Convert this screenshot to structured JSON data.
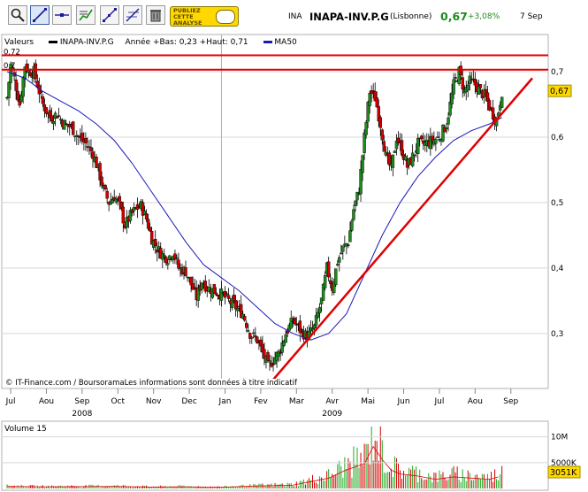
{
  "toolbar": {
    "buttons": [
      {
        "name": "zoom-button",
        "icon": "zoom-icon"
      },
      {
        "name": "trendline-tool-button",
        "icon": "trendline-icon",
        "selected": true
      },
      {
        "name": "horizontal-line-tool-button",
        "icon": "horizontal-line-icon"
      },
      {
        "name": "indicator-button",
        "icon": "indicator-chart-icon"
      },
      {
        "name": "trendline-alt-button",
        "icon": "trendline-icon"
      },
      {
        "name": "fibonacci-button",
        "icon": "fibonacci-icon"
      },
      {
        "name": "delete-button",
        "icon": "trash-icon"
      }
    ],
    "ad_text": [
      "PUBLIEZ",
      "CETTE",
      "ANALYSE"
    ]
  },
  "header": {
    "code": "INA",
    "name": "INAPA-INV.P.G",
    "market": "(Lisbonne)",
    "price": "0,67",
    "change": "+3,08%",
    "date": "7 Sep",
    "price_color": "#1e8a1e"
  },
  "legend": {
    "series_label": "Valeurs",
    "ticker": "INAPA-INV.P.G",
    "range": "Année +Bas: 0,23 +Haut: 0,71",
    "ma_label": "MA50"
  },
  "credit": "© IT-Finance.com / BoursoramaLes informations sont données à titre indicatif",
  "volume_label": "Volume 15",
  "colors": {
    "up": "#1e8a1e",
    "down": "#d00000",
    "ma": "#1a1ab8",
    "line": "#e00000",
    "volume": "#22aa22",
    "grid": "#d8d8d8"
  },
  "chart_data": {
    "type": "candlestick",
    "ylim": [
      0.22,
      0.75
    ],
    "yticks": [
      "0,3",
      "0,4",
      "0,5",
      "0,6",
      "0,7"
    ],
    "ytick_values": [
      0.3,
      0.4,
      0.5,
      0.6,
      0.7
    ],
    "left_axis_labels": [
      "0,72",
      "0,7"
    ],
    "last_price_label": "0,67",
    "x_months": [
      "Jul",
      "Aou",
      "Sep",
      "Oct",
      "Nov",
      "Dec",
      "Jan",
      "Fev",
      "Mar",
      "Avr",
      "Mai",
      "Jun",
      "Jul",
      "Aou",
      "Sep"
    ],
    "x_years": [
      {
        "label": "2008",
        "month_index": 2
      },
      {
        "label": "2009",
        "month_index": 9
      }
    ],
    "horizontal_lines": [
      0.725,
      0.703
    ],
    "trendline": [
      {
        "month": 7.3,
        "price": 0.22
      },
      {
        "month": 14.7,
        "price": 0.69
      }
    ],
    "close_path": [
      [
        0.0,
        0.66
      ],
      [
        0.1,
        0.71
      ],
      [
        0.2,
        0.69
      ],
      [
        0.35,
        0.65
      ],
      [
        0.5,
        0.71
      ],
      [
        0.6,
        0.7
      ],
      [
        0.75,
        0.7
      ],
      [
        0.9,
        0.67
      ],
      [
        1.0,
        0.65
      ],
      [
        1.2,
        0.63
      ],
      [
        1.4,
        0.635
      ],
      [
        1.6,
        0.62
      ],
      [
        1.8,
        0.615
      ],
      [
        2.0,
        0.6
      ],
      [
        2.2,
        0.59
      ],
      [
        2.4,
        0.575
      ],
      [
        2.55,
        0.55
      ],
      [
        2.7,
        0.52
      ],
      [
        2.85,
        0.5
      ],
      [
        3.0,
        0.51
      ],
      [
        3.15,
        0.495
      ],
      [
        3.3,
        0.465
      ],
      [
        3.45,
        0.48
      ],
      [
        3.6,
        0.49
      ],
      [
        3.75,
        0.495
      ],
      [
        3.9,
        0.475
      ],
      [
        4.05,
        0.445
      ],
      [
        4.2,
        0.43
      ],
      [
        4.35,
        0.42
      ],
      [
        4.5,
        0.415
      ],
      [
        4.65,
        0.425
      ],
      [
        4.8,
        0.4
      ],
      [
        5.0,
        0.395
      ],
      [
        5.15,
        0.375
      ],
      [
        5.3,
        0.355
      ],
      [
        5.45,
        0.38
      ],
      [
        5.6,
        0.37
      ],
      [
        5.8,
        0.365
      ],
      [
        6.0,
        0.36
      ],
      [
        6.2,
        0.35
      ],
      [
        6.4,
        0.34
      ],
      [
        6.6,
        0.33
      ],
      [
        6.8,
        0.3
      ],
      [
        7.0,
        0.29
      ],
      [
        7.15,
        0.27
      ],
      [
        7.3,
        0.25
      ],
      [
        7.45,
        0.26
      ],
      [
        7.6,
        0.27
      ],
      [
        7.8,
        0.3
      ],
      [
        8.0,
        0.32
      ],
      [
        8.2,
        0.305
      ],
      [
        8.4,
        0.295
      ],
      [
        8.6,
        0.31
      ],
      [
        8.8,
        0.35
      ],
      [
        8.95,
        0.4
      ],
      [
        9.1,
        0.37
      ],
      [
        9.25,
        0.41
      ],
      [
        9.4,
        0.43
      ],
      [
        9.55,
        0.44
      ],
      [
        9.7,
        0.49
      ],
      [
        9.85,
        0.52
      ],
      [
        10.0,
        0.6
      ],
      [
        10.15,
        0.67
      ],
      [
        10.3,
        0.66
      ],
      [
        10.45,
        0.62
      ],
      [
        10.6,
        0.57
      ],
      [
        10.75,
        0.55
      ],
      [
        10.9,
        0.6
      ],
      [
        11.05,
        0.58
      ],
      [
        11.2,
        0.555
      ],
      [
        11.35,
        0.57
      ],
      [
        11.5,
        0.59
      ],
      [
        11.7,
        0.59
      ],
      [
        11.9,
        0.595
      ],
      [
        12.1,
        0.6
      ],
      [
        12.3,
        0.62
      ],
      [
        12.5,
        0.68
      ],
      [
        12.65,
        0.7
      ],
      [
        12.8,
        0.67
      ],
      [
        12.95,
        0.685
      ],
      [
        13.1,
        0.68
      ],
      [
        13.25,
        0.67
      ],
      [
        13.4,
        0.66
      ],
      [
        13.55,
        0.64
      ],
      [
        13.7,
        0.625
      ],
      [
        13.85,
        0.67
      ]
    ],
    "ma50_path": [
      [
        0.0,
        0.7
      ],
      [
        0.5,
        0.69
      ],
      [
        1.0,
        0.67
      ],
      [
        1.5,
        0.655
      ],
      [
        2.0,
        0.64
      ],
      [
        2.5,
        0.62
      ],
      [
        3.0,
        0.595
      ],
      [
        3.5,
        0.56
      ],
      [
        4.0,
        0.52
      ],
      [
        4.5,
        0.48
      ],
      [
        5.0,
        0.44
      ],
      [
        5.5,
        0.405
      ],
      [
        6.0,
        0.385
      ],
      [
        6.5,
        0.365
      ],
      [
        7.0,
        0.34
      ],
      [
        7.5,
        0.315
      ],
      [
        8.0,
        0.3
      ],
      [
        8.5,
        0.29
      ],
      [
        9.0,
        0.3
      ],
      [
        9.5,
        0.33
      ],
      [
        10.0,
        0.39
      ],
      [
        10.5,
        0.45
      ],
      [
        11.0,
        0.5
      ],
      [
        11.5,
        0.54
      ],
      [
        12.0,
        0.57
      ],
      [
        12.5,
        0.595
      ],
      [
        13.0,
        0.61
      ],
      [
        13.5,
        0.62
      ],
      [
        13.85,
        0.63
      ]
    ],
    "volume_ticks": [
      "10M",
      "5000K"
    ],
    "volume_tick_values": [
      10000000,
      5000000
    ],
    "volume_last_label": "3051K",
    "volume_ylim": [
      0,
      12000000
    ],
    "volume_profile": [
      [
        0,
        0.5
      ],
      [
        1,
        0.4
      ],
      [
        2,
        0.45
      ],
      [
        3,
        0.5
      ],
      [
        4,
        0.35
      ],
      [
        5,
        0.4
      ],
      [
        6,
        0.3
      ],
      [
        7,
        0.6
      ],
      [
        8,
        0.8
      ],
      [
        9,
        2.5
      ],
      [
        9.5,
        4.5
      ],
      [
        10,
        6
      ],
      [
        10.3,
        11
      ],
      [
        10.6,
        5
      ],
      [
        11,
        3.5
      ],
      [
        11.5,
        3
      ],
      [
        12,
        2.2
      ],
      [
        12.5,
        2.8
      ],
      [
        13,
        2.5
      ],
      [
        13.5,
        2.2
      ],
      [
        13.85,
        3.05
      ]
    ]
  }
}
